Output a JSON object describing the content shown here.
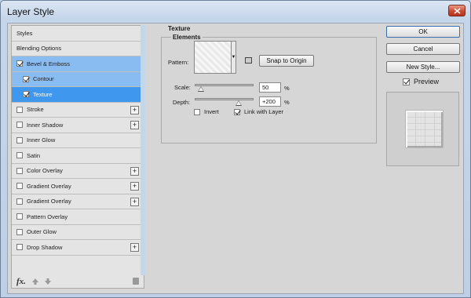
{
  "window": {
    "title": "Layer Style"
  },
  "styles_list": {
    "header": "Styles",
    "items": [
      {
        "label": "Blending Options",
        "checkbox": false,
        "checked": false,
        "plus": false,
        "state": "normal"
      },
      {
        "label": "Bevel & Emboss",
        "checkbox": true,
        "checked": true,
        "plus": false,
        "state": "selected-light"
      },
      {
        "label": "Contour",
        "checkbox": true,
        "checked": true,
        "plus": false,
        "state": "selected-light",
        "sub": true
      },
      {
        "label": "Texture",
        "checkbox": true,
        "checked": true,
        "plus": false,
        "state": "selected",
        "sub": true
      },
      {
        "label": "Stroke",
        "checkbox": true,
        "checked": false,
        "plus": true,
        "state": "normal"
      },
      {
        "label": "Inner Shadow",
        "checkbox": true,
        "checked": false,
        "plus": true,
        "state": "normal"
      },
      {
        "label": "Inner Glow",
        "checkbox": true,
        "checked": false,
        "plus": false,
        "state": "normal"
      },
      {
        "label": "Satin",
        "checkbox": true,
        "checked": false,
        "plus": false,
        "state": "normal"
      },
      {
        "label": "Color Overlay",
        "checkbox": true,
        "checked": false,
        "plus": true,
        "state": "normal"
      },
      {
        "label": "Gradient Overlay",
        "checkbox": true,
        "checked": false,
        "plus": true,
        "state": "normal"
      },
      {
        "label": "Gradient Overlay",
        "checkbox": true,
        "checked": false,
        "plus": true,
        "state": "normal"
      },
      {
        "label": "Pattern Overlay",
        "checkbox": true,
        "checked": false,
        "plus": false,
        "state": "normal"
      },
      {
        "label": "Outer Glow",
        "checkbox": true,
        "checked": false,
        "plus": false,
        "state": "normal"
      },
      {
        "label": "Drop Shadow",
        "checkbox": true,
        "checked": false,
        "plus": true,
        "state": "normal"
      }
    ],
    "footer_fx": "fx."
  },
  "texture": {
    "section_title": "Texture",
    "group_label": "Elements",
    "pattern_label": "Pattern:",
    "snap_button": "Snap to Origin",
    "scale_label": "Scale:",
    "scale_value": "50",
    "scale_unit": "%",
    "scale_fraction": 0.1,
    "depth_label": "Depth:",
    "depth_value": "+200",
    "depth_unit": "%",
    "depth_fraction": 0.75,
    "invert_label": "Invert",
    "invert_checked": false,
    "link_label": "Link with Layer",
    "link_checked": true
  },
  "actions": {
    "ok": "OK",
    "cancel": "Cancel",
    "new_style": "New Style...",
    "preview_label": "Preview",
    "preview_checked": true
  }
}
